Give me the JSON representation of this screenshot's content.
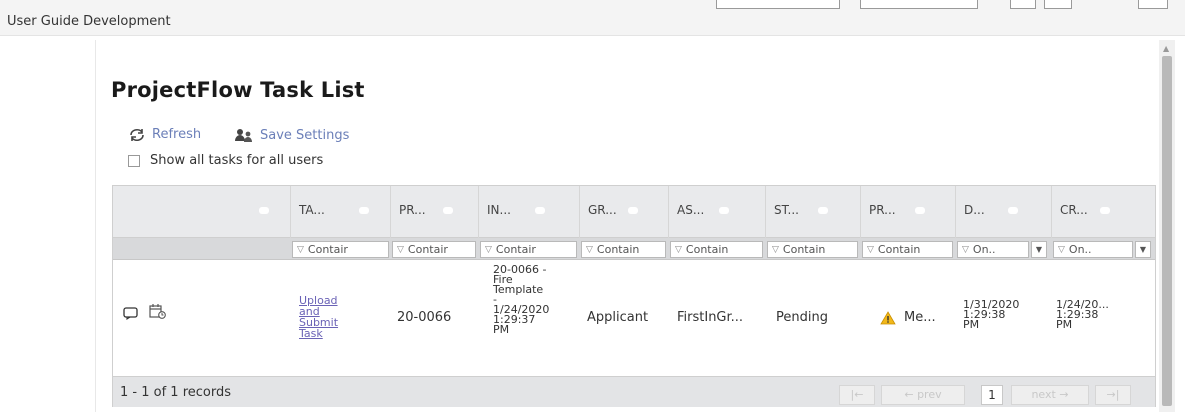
{
  "topbar": {
    "breadcrumb": "User Guide Development"
  },
  "page": {
    "title": "ProjectFlow Task List"
  },
  "toolbar": {
    "refresh_label": "Refresh",
    "refresh_icon": "refresh-icon",
    "save_settings_label": "Save Settings",
    "save_settings_icon": "users-settings-icon",
    "show_all_label": "Show all tasks for all users",
    "show_all_checked": false
  },
  "grid": {
    "columns": [
      {
        "label": "TA..."
      },
      {
        "label": "PR..."
      },
      {
        "label": "IN..."
      },
      {
        "label": "GR..."
      },
      {
        "label": "AS..."
      },
      {
        "label": "ST..."
      },
      {
        "label": "PR..."
      },
      {
        "label": "D..."
      },
      {
        "label": "CR..."
      }
    ],
    "filters": [
      "Contair",
      "Contair",
      "Contair",
      "Contain",
      "Contain",
      "Contain",
      "Contain",
      "On..",
      "On.."
    ],
    "rows": [
      {
        "icons": [
          "comment-icon",
          "task-calendar-icon"
        ],
        "task_lines": [
          "Upload",
          "and",
          "Submit",
          "Task"
        ],
        "project": "20-0066",
        "instance_lines": [
          "20-0066 -",
          "Fire",
          "Template",
          "-",
          "1/24/2020",
          "1:29:37",
          "PM"
        ],
        "group": "Applicant",
        "assigned": "FirstInGr...",
        "status": "Pending",
        "priority_icon": "warning-icon",
        "priority": "Me...",
        "due_lines": [
          "1/31/2020",
          "1:29:38",
          "PM"
        ],
        "created_lines": [
          "1/24/20...",
          "1:29:38",
          "PM"
        ]
      }
    ]
  },
  "pager": {
    "records_text": "1 - 1 of 1 records",
    "first_label": "|←",
    "prev_label": "← prev",
    "current_page": "1",
    "next_label": "next →",
    "last_label": "→|"
  }
}
